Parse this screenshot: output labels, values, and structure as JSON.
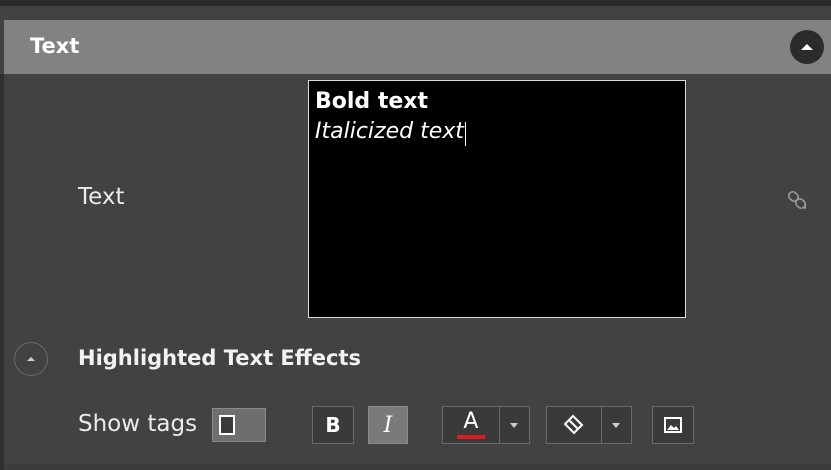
{
  "panel": {
    "section_title": "Text"
  },
  "text_property": {
    "label": "Text",
    "line_bold": "Bold text",
    "line_italic": "Italicized text"
  },
  "highlighted_effects": {
    "title": "Highlighted Text Effects",
    "show_tags_label": "Show tags",
    "show_tags_checked": false
  },
  "toolbar": {
    "bold_label": "B",
    "italic_label": "I",
    "font_color_letter": "A",
    "font_color": "#e0191b",
    "italic_active": true
  },
  "icons": {
    "collapse": "chevron-up-icon",
    "link": "link-icon",
    "fill": "paint-bucket-icon",
    "image": "image-icon",
    "dropdown": "caret-down-icon"
  },
  "colors": {
    "header_bg": "#828282",
    "panel_bg": "#424242",
    "editor_bg": "#000000",
    "accent_red": "#e0191b"
  }
}
